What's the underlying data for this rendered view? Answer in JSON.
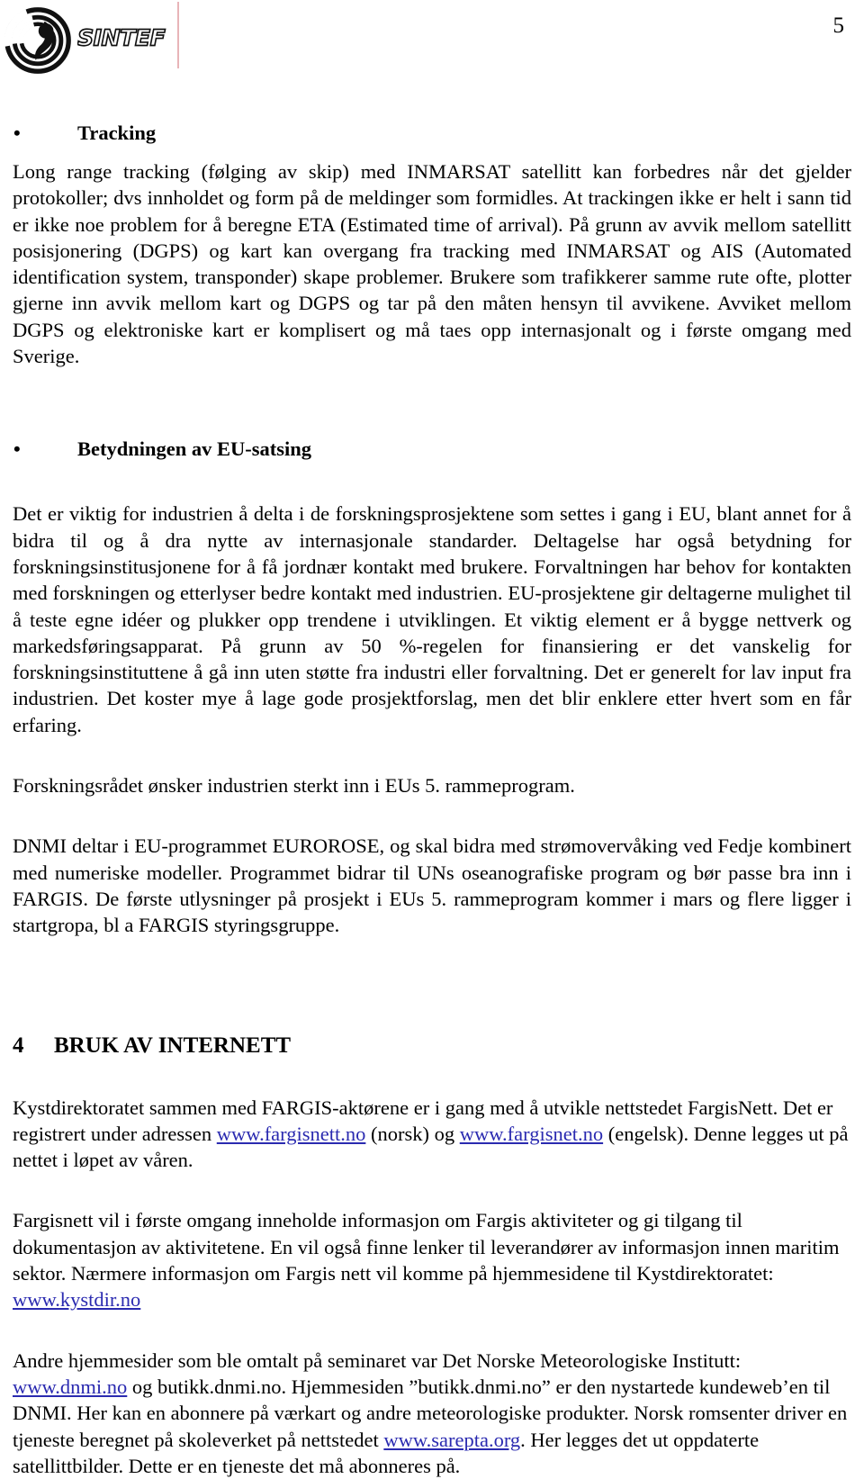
{
  "header": {
    "logo_text": "SINTEF",
    "logo_mark_name": "sintef-spiral-logo",
    "page_number": "5"
  },
  "content": {
    "bullet_glyph": "•",
    "section_tracking": {
      "heading": "Tracking",
      "paragraph": "Long range tracking (følging av skip) med INMARSAT satellitt  kan forbedres når det gjelder protokoller; dvs innholdet og form på de meldinger som formidles. At trackingen ikke er helt i sann tid er ikke noe problem for å beregne ETA (Estimated time of arrival). På grunn av avvik mellom satellitt posisjonering (DGPS) og kart kan overgang fra tracking med INMARSAT og AIS (Automated identification system, transponder) skape problemer. Brukere som trafikkerer samme rute ofte, plotter gjerne inn avvik mellom kart og DGPS og tar på den måten hensyn til avvikene. Avviket mellom DGPS og elektroniske kart er komplisert og må taes opp internasjonalt og i første omgang med Sverige."
    },
    "section_eu": {
      "heading": "Betydningen av EU-satsing",
      "paragraph_1": "Det er viktig for industrien å delta i de forskningsprosjektene som settes i gang i EU, blant annet for å bidra til og å dra nytte av internasjonale standarder. Deltagelse har også betydning for forskningsinstitusjonene for å få jordnær kontakt med brukere. Forvaltningen har behov for kontakten med forskningen og etterlyser bedre kontakt med industrien. EU-prosjektene gir deltagerne mulighet til å teste egne idéer og plukker opp trendene i utviklingen. Et viktig element er å bygge nettverk og markedsføringsapparat. På grunn av 50 %-regelen for finansiering er det vanskelig for forskningsinstituttene å gå inn uten støtte fra industri eller forvaltning. Det er generelt for lav input fra industrien. Det koster mye å lage gode prosjektforslag, men det blir enklere etter hvert som en får erfaring.",
      "paragraph_2": "Forskningsrådet ønsker industrien sterkt inn i EUs 5. rammeprogram.",
      "paragraph_3": "DNMI deltar i EU-programmet EUROROSE, og skal bidra med strømovervåking ved Fedje kombinert med numeriske modeller. Programmet bidrar til UNs oseanografiske program og bør passe bra inn i FARGIS. De første utlysninger på prosjekt i EUs 5. rammeprogram kommer i mars og flere ligger i startgropa, bl a FARGIS styringsgruppe."
    },
    "section_internet": {
      "number": "4",
      "heading": "BRUK AV INTERNETT",
      "paragraph_1_part_a": "Kystdirektoratet sammen med FARGIS-aktørene er i gang med å utvikle nettstedet FargisNett. Det er registrert under adressen ",
      "paragraph_1_link_1": "www.fargisnett.no",
      "paragraph_1_part_b": " (norsk) og ",
      "paragraph_1_link_2": "www.fargisnet.no",
      "paragraph_1_part_c": " (engelsk). Denne legges ut på nettet i løpet av våren.",
      "paragraph_2_part_a": "Fargisnett vil i første omgang inneholde informasjon om Fargis aktiviteter og gi tilgang til dokumentasjon av aktivitetene. En vil også finne lenker til leverandører av informasjon innen maritim sektor. Nærmere informasjon om Fargis nett vil komme på hjemmesidene til Kystdirektoratet: ",
      "paragraph_2_link_1": "www.kystdir.no",
      "paragraph_3_part_a": "Andre hjemmesider som ble omtalt på seminaret var Det Norske Meteorologiske Institutt: ",
      "paragraph_3_link_1": "www.dnmi.no",
      "paragraph_3_part_b": " og butikk.dnmi.no. Hjemmesiden ”butikk.dnmi.no” er den nystartede kundeweb’en til DNMI. Her kan en abonnere på værkart og andre meteorologiske produkter. Norsk romsenter driver en tjeneste beregnet på skoleverket på nettstedet ",
      "paragraph_3_link_2": "www.sarepta.org",
      "paragraph_3_part_c": ". Her  legges det ut oppdaterte satellittbilder. Dette er en tjeneste det må abonneres på."
    }
  },
  "colors": {
    "link": "#2a2ab0",
    "logo_rule": "#e8b4b8",
    "text": "#000000"
  }
}
